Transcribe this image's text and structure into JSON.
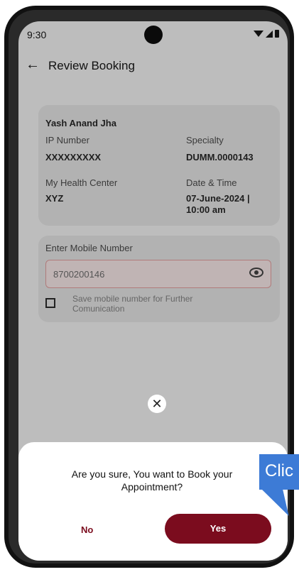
{
  "status_bar": {
    "time": "9:30"
  },
  "header": {
    "back_icon": "arrow-left-icon",
    "title": "Review Booking"
  },
  "patient": {
    "name": "Yash Anand Jha",
    "ip_number_label": "IP Number",
    "ip_number_value": "XXXXXXXXX",
    "specialty_label": "Specialty",
    "specialty_value": "DUMM.0000143",
    "health_center_label": "My Health Center",
    "health_center_value": "XYZ",
    "date_time_label": "Date & Time",
    "date_time_value_line1": "07-June-2024 |",
    "date_time_value_line2": "10:00 am"
  },
  "mobile": {
    "label": "Enter Mobile Number",
    "value": "8700200146",
    "eye_icon": "eye-icon",
    "save_label": "Save mobile number for Further Comunication"
  },
  "close_icon": "close-icon",
  "dialog": {
    "question": "Are you sure, You want to Book your Appointment?",
    "no_label": "No",
    "yes_label": "Yes"
  },
  "callout": {
    "text": "Clic"
  },
  "colors": {
    "primary": "#7b0c1e",
    "callout": "#3d7bd6"
  }
}
